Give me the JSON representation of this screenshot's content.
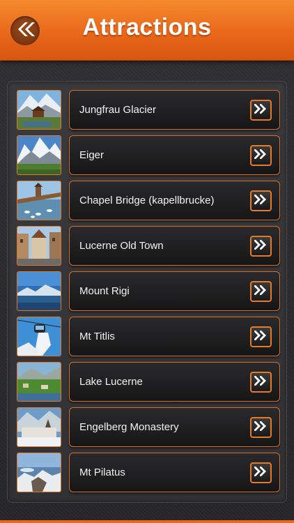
{
  "header": {
    "title": "Attractions",
    "back_icon": "double-chevron-left-icon"
  },
  "colors": {
    "accent": "#e9681a",
    "header_top": "#f58a2e",
    "background": "#2b2b2d",
    "row_bar": "#1f1f20",
    "label_text": "#f2f2f2"
  },
  "attractions": [
    {
      "label": "Jungfrau Glacier",
      "thumb": "mountain-lake-chalet"
    },
    {
      "label": "Eiger",
      "thumb": "snowy-peaks-meadow"
    },
    {
      "label": "Chapel Bridge (kapellbrucke)",
      "thumb": "covered-bridge-swans"
    },
    {
      "label": "Lucerne Old Town",
      "thumb": "old-town-street"
    },
    {
      "label": "Mount Rigi",
      "thumb": "lake-mountain-vista"
    },
    {
      "label": "Mt Titlis",
      "thumb": "cable-car-snow"
    },
    {
      "label": "Lake Lucerne",
      "thumb": "green-hills-lake"
    },
    {
      "label": "Engelberg Monastery",
      "thumb": "monastery-valley"
    },
    {
      "label": "Mt Pilatus",
      "thumb": "mountain-ridge-lake"
    }
  ],
  "row_arrow_icon": "double-chevron-right-icon"
}
